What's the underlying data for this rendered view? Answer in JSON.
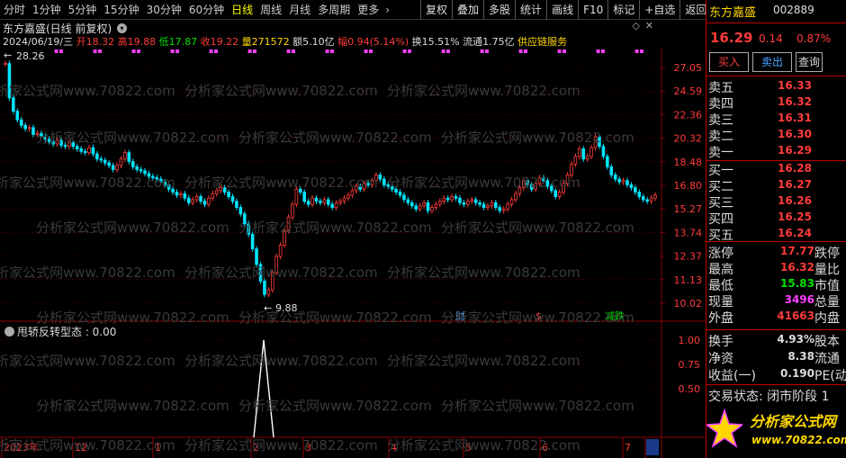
{
  "toolbar": {
    "periods": [
      {
        "label": "分时",
        "active": false
      },
      {
        "label": "1分钟",
        "active": false
      },
      {
        "label": "5分钟",
        "active": false
      },
      {
        "label": "15分钟",
        "active": false
      },
      {
        "label": "30分钟",
        "active": false
      },
      {
        "label": "60分钟",
        "active": false
      },
      {
        "label": "日线",
        "active": true
      },
      {
        "label": "周线",
        "active": false
      },
      {
        "label": "月线",
        "active": false
      },
      {
        "label": "多周期",
        "active": false
      },
      {
        "label": "更多",
        "active": false
      }
    ],
    "more_arrow": "›",
    "tools": [
      "复权",
      "叠加",
      "多股",
      "统计",
      "画线",
      "F10",
      "标记",
      "+自选",
      "返回"
    ]
  },
  "chart": {
    "stock_name": "东方嘉盛(日线 前复权)",
    "info": {
      "date": "2024/06/19/三",
      "open_label": "开",
      "open": "18.32",
      "high_label": "高",
      "high": "19.88",
      "low_label": "低",
      "low": "17.87",
      "close_label": "收",
      "close": "19.22",
      "volume_label": "量",
      "volume": "271572",
      "amount_label": "额",
      "amount": "5.10亿",
      "range_label": "幅",
      "range": "0.94(5.14%)",
      "turnover_label": "换",
      "turnover": "15.51%",
      "float_label": "流通",
      "float": "1.75亿",
      "concept": "供应链服务"
    },
    "price_axis": [
      "27.05",
      "24.59",
      "22.36",
      "20.32",
      "18.48",
      "16.80",
      "15.27",
      "13.74",
      "12.37",
      "11.13",
      "10.02"
    ],
    "high_mark": "28.26",
    "low_mark": "9.88",
    "event_markers": [
      {
        "label": "财",
        "color": "#4aa3ff"
      },
      {
        "label": "$",
        "color": "#ff3b3b"
      },
      {
        "label": "减跌",
        "color": "#00e000"
      }
    ],
    "indicator": {
      "label": "甩轿反转型态 : 0.00",
      "axis": [
        "1.00",
        "0.75",
        "0.50"
      ]
    },
    "x_axis": [
      "2023年",
      "12",
      "1",
      "2",
      "3",
      "4",
      "5",
      "6",
      "7",
      "--"
    ],
    "watermark": "分析家公式网www.70822.com"
  },
  "right_panel": {
    "name": "东方嘉盛",
    "code": "002889",
    "price": "16.29",
    "change": "0.14",
    "change_pct": "0.87%",
    "buttons": [
      "买入",
      "卖出",
      "查询"
    ],
    "asks": [
      {
        "label": "卖五",
        "price": "16.33"
      },
      {
        "label": "卖四",
        "price": "16.32"
      },
      {
        "label": "卖三",
        "price": "16.31"
      },
      {
        "label": "卖二",
        "price": "16.30"
      },
      {
        "label": "卖一",
        "price": "16.29"
      }
    ],
    "bids": [
      {
        "label": "买一",
        "price": "16.28"
      },
      {
        "label": "买二",
        "price": "16.27"
      },
      {
        "label": "买三",
        "price": "16.26"
      },
      {
        "label": "买四",
        "price": "16.25"
      },
      {
        "label": "买五",
        "price": "16.24"
      }
    ],
    "stats": [
      {
        "label": "涨停",
        "value": "17.77",
        "color": "#ff3b3b",
        "label2": "跌停"
      },
      {
        "label": "最高",
        "value": "16.32",
        "color": "#ff3b3b",
        "label2": "量比"
      },
      {
        "label": "最低",
        "value": "15.83",
        "color": "#00e000",
        "label2": "市值"
      },
      {
        "label": "现量",
        "value": "3496",
        "color": "#ff40ff",
        "label2": "总量"
      },
      {
        "label": "外盘",
        "value": "41663",
        "color": "#ff3b3b",
        "label2": "内盘"
      }
    ],
    "stats2": [
      {
        "label": "换手",
        "value": "4.93%",
        "label2": "股本"
      },
      {
        "label": "净资",
        "value": "8.38",
        "label2": "流通"
      },
      {
        "label": "收益(一)",
        "value": "0.190",
        "label2": "PE(动"
      }
    ],
    "trade_state": "交易状态: 闭市阶段 1",
    "logo_title": "分析家公式网",
    "logo_url": "www.70822.com"
  },
  "colors": {
    "up": "#ff3b3b",
    "down": "#00e5ff",
    "grid": "#8b0000",
    "axis_text": "#ff3b3b"
  }
}
